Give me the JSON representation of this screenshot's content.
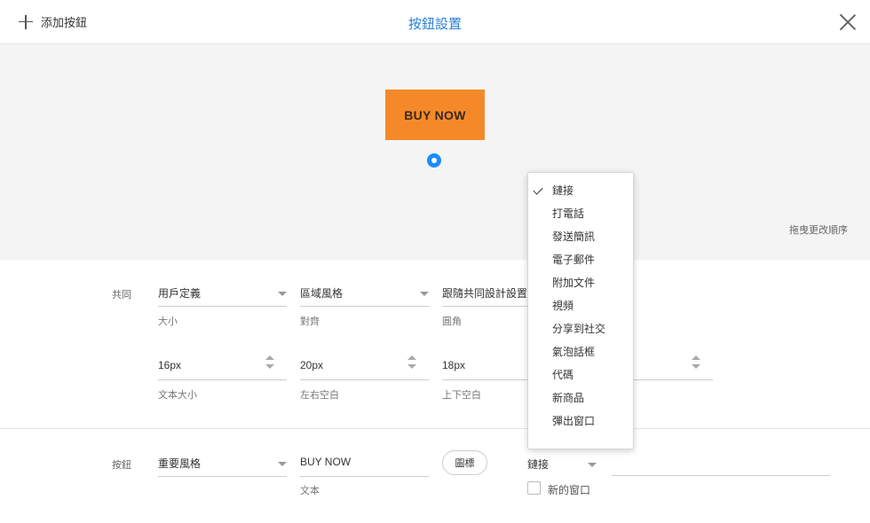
{
  "header": {
    "add_label": "添加按鈕",
    "title": "按鈕設置"
  },
  "preview": {
    "button_text": "BUY NOW",
    "drag_hint": "拖曳更改順序"
  },
  "common": {
    "label": "共同",
    "size": {
      "value": "用戶定義",
      "label": "大小"
    },
    "alignment": {
      "value": "區域風格",
      "label": "對齊"
    },
    "corner": {
      "value": "跟隨共同設計設置",
      "label": "圓角"
    },
    "font_size": {
      "value": "16px",
      "label": "文本大小"
    },
    "h_padding": {
      "value": "20px",
      "label": "左右空白"
    },
    "v_padding": {
      "value": "18px",
      "label": "上下空白"
    }
  },
  "button": {
    "label": "按鈕",
    "style": {
      "value": "重要風格"
    },
    "text": {
      "value": "BUY NOW",
      "label": "文本"
    },
    "icon_label": "圖標",
    "link_type": {
      "value": "鏈接"
    },
    "new_window_label": "新的窗口",
    "new_window_checked": false
  },
  "dropdown": {
    "selected": "鏈接",
    "items": [
      "鏈接",
      "打電話",
      "發送簡訊",
      "電子郵件",
      "附加文件",
      "視頻",
      "分享到社交",
      "氣泡話框",
      "代碼",
      "新商品",
      "彈出窗口"
    ]
  },
  "colors": {
    "accent": "#2b7fd4",
    "button_bg": "#f5892a",
    "handle": "#1a8cff",
    "preview_bg": "#f4f4f5"
  }
}
